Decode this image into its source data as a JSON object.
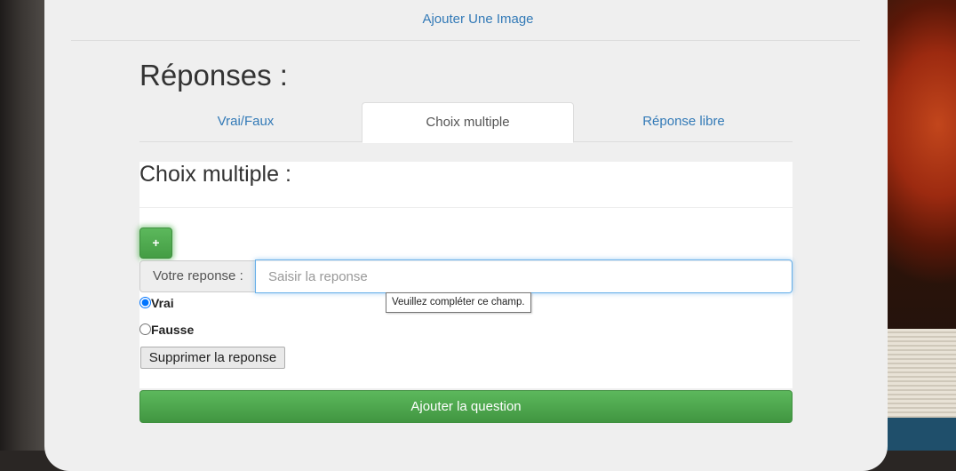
{
  "header": {
    "add_image_link": "Ajouter Une Image"
  },
  "answers": {
    "title": "Réponses :",
    "tabs": [
      {
        "label": "Vrai/Faux",
        "active": false
      },
      {
        "label": "Choix multiple",
        "active": true
      },
      {
        "label": "Réponse libre",
        "active": false
      }
    ]
  },
  "multiple_choice": {
    "title": "Choix multiple :",
    "add_button_label": "+",
    "response_label": "Votre reponse :",
    "response_placeholder": "Saisir la reponse",
    "response_value": "",
    "validation_tooltip": "Veuillez compléter ce champ.",
    "options": [
      {
        "label": "Vrai",
        "checked": true
      },
      {
        "label": "Fausse",
        "checked": false
      }
    ],
    "delete_button_label": "Supprimer la reponse"
  },
  "footer": {
    "submit_button_label": "Ajouter la question"
  },
  "colors": {
    "link": "#337ab7",
    "success": "#5cb85c",
    "panel_bg": "#efefef"
  }
}
